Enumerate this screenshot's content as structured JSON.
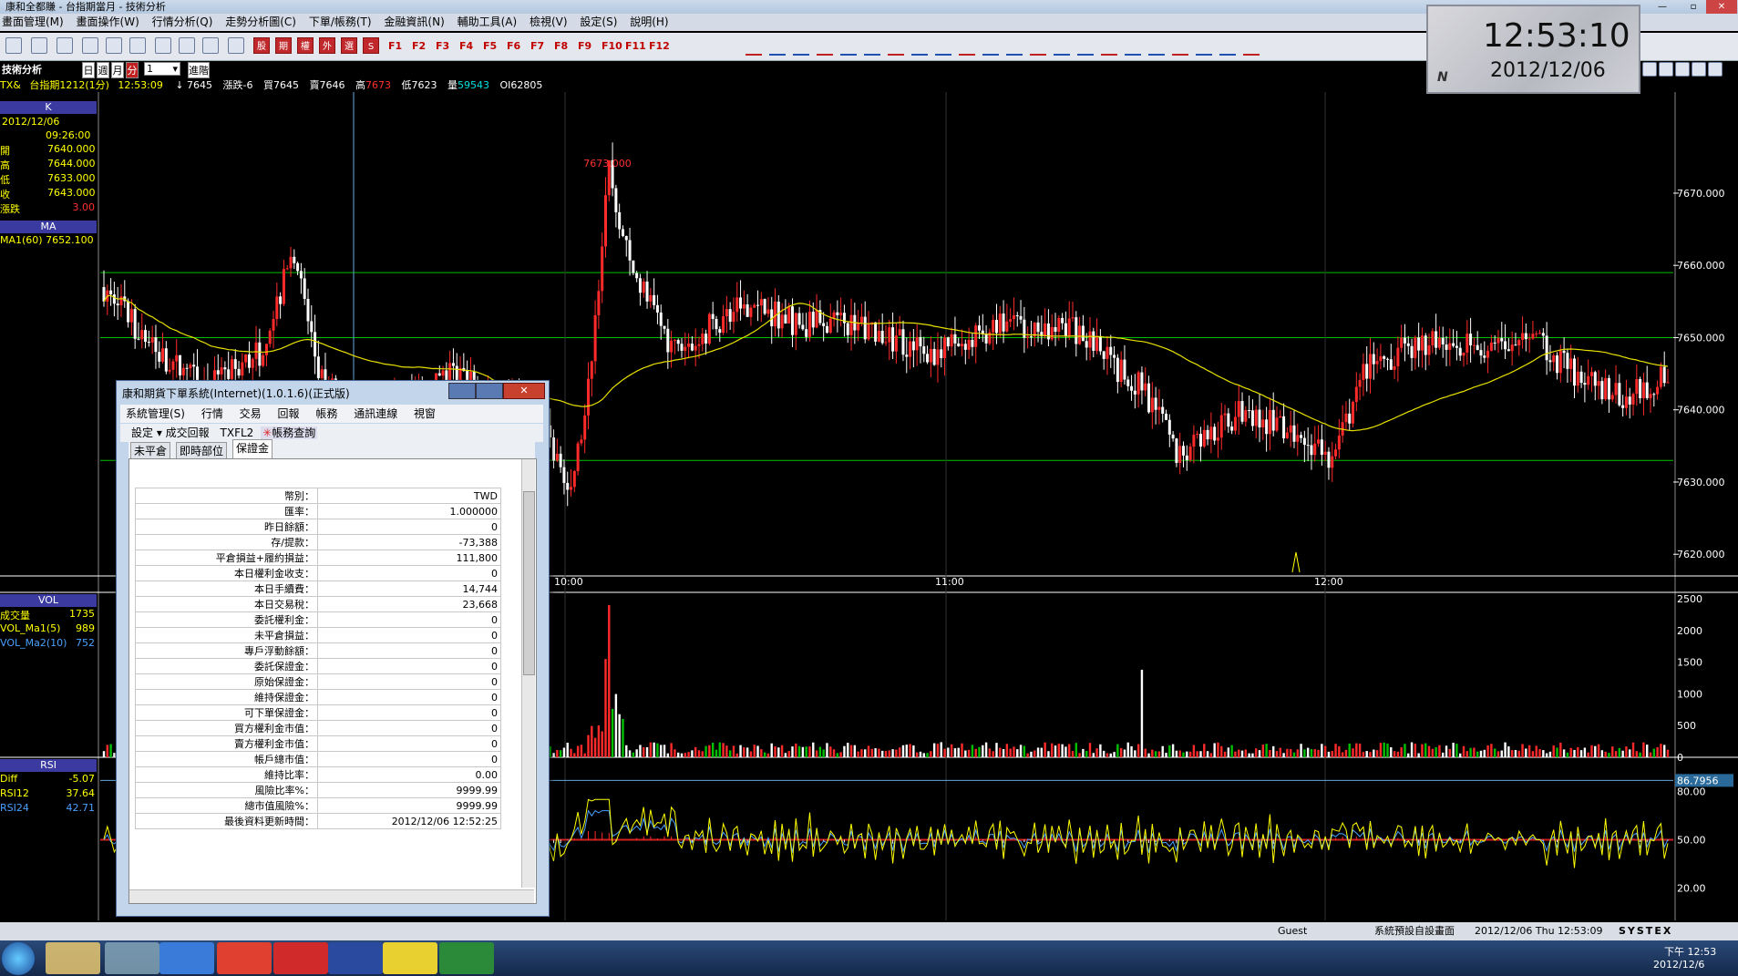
{
  "window": {
    "title": "康和全都賺 - 台指期當月 - 技術分析"
  },
  "menu": [
    "畫面管理(M)",
    "畫面操作(W)",
    "行情分析(Q)",
    "走勢分析圖(C)",
    "下單/帳務(T)",
    "金融資訊(N)",
    "輔助工具(A)",
    "檢視(V)",
    "設定(S)",
    "說明(H)"
  ],
  "toolbar": {
    "red_buttons": [
      "股",
      "期",
      "權",
      "外",
      "選",
      "S"
    ],
    "function_keys": [
      "F1",
      "F2",
      "F3",
      "F4",
      "F5",
      "F6",
      "F7",
      "F8",
      "F9",
      "F10",
      "F11",
      "F12"
    ]
  },
  "chart_panel": {
    "title": "技術分析",
    "period_tabs": [
      "日",
      "週",
      "月",
      "分"
    ],
    "active_period": "分",
    "interval_value": "1",
    "advanced_label": "進階",
    "symbol": "TX&",
    "symbol_name": "台指期1212(1分)",
    "time": "12:53:09",
    "last_arrow": "↓",
    "last": "7645",
    "change_label": "漲跌",
    "change": "-6",
    "bid_label": "買",
    "bid": "7645",
    "ask_label": "賣",
    "ask": "7646",
    "high_label": "高",
    "high": "7673",
    "low_label": "低",
    "low": "7623",
    "volume_label": "量",
    "volume": "59543",
    "oi_label": "OI",
    "oi": "62805"
  },
  "side": {
    "k_header": "K",
    "date": "2012/12/06",
    "time": "09:26:00",
    "ohlc": [
      {
        "label": "開",
        "value": "7640.000"
      },
      {
        "label": "高",
        "value": "7644.000"
      },
      {
        "label": "低",
        "value": "7633.000"
      },
      {
        "label": "收",
        "value": "7643.000"
      },
      {
        "label": "漲跌",
        "value": "3.00"
      }
    ],
    "ma_header": "MA",
    "ma_label": "MA1(60)",
    "ma_value": "7652.100",
    "vol_header": "VOL",
    "vol": [
      {
        "label": "成交量",
        "value": "1735"
      },
      {
        "label": "VOL_Ma1(5)",
        "value": "989"
      },
      {
        "label": "VOL_Ma2(10)",
        "value": "752"
      }
    ],
    "rsi_header": "RSI",
    "rsi": [
      {
        "label": "Diff",
        "value": "-5.07"
      },
      {
        "label": "RSI12",
        "value": "37.64"
      },
      {
        "label": "RSI24",
        "value": "42.71"
      }
    ]
  },
  "clock": {
    "time": "12:53:10",
    "date": "2012/12/06",
    "badge": "N"
  },
  "chart_data": [
    {
      "type": "candlestick",
      "title": "",
      "y_ticks": [
        "7670.000",
        "7660.000",
        "7650.000",
        "7640.000",
        "7630.000",
        "7620.000"
      ],
      "ylim": [
        7617,
        7684
      ],
      "x_tick_labels": [
        "10:00",
        "11:00",
        "12:00"
      ],
      "hlines": [
        7659,
        7650,
        7633
      ],
      "high_annotation": "7673.000",
      "grid": true,
      "series": [
        {
          "name": "MA1(60)"
        }
      ]
    },
    {
      "type": "bar",
      "title": "VOL",
      "y_ticks": [
        "2500",
        "2000",
        "1500",
        "1000",
        "500",
        "0"
      ],
      "ylim": [
        0,
        2600
      ]
    },
    {
      "type": "line",
      "title": "RSI",
      "y_ticks": [
        "86.7956",
        "80.00",
        "50.00",
        "20.00"
      ],
      "ylim": [
        0,
        100
      ],
      "series": [
        {
          "name": "RSI12"
        },
        {
          "name": "RSI24"
        }
      ]
    }
  ],
  "dialog": {
    "title": "康和期貨下單系統(Internet)(1.0.1.6)(正式版)",
    "menu": [
      "系統管理(S)",
      "行情",
      "交易",
      "回報",
      "帳務",
      "通訊連線",
      "視窗"
    ],
    "sub": {
      "settings": "設定",
      "fills": "成交回報",
      "product": "TXFL2",
      "account_query": "帳務查詢"
    },
    "tabs": [
      "未平倉",
      "即時部位",
      "保證金"
    ],
    "active_tab": "保證金",
    "rows": [
      {
        "k": "幣別：",
        "v": "TWD"
      },
      {
        "k": "匯率：",
        "v": "1.000000"
      },
      {
        "k": "昨日餘額：",
        "v": "0"
      },
      {
        "k": "存/提款：",
        "v": "-73,388"
      },
      {
        "k": "平倉損益+履約損益：",
        "v": "111,800"
      },
      {
        "k": "本日權利金收支：",
        "v": "0"
      },
      {
        "k": "本日手續費：",
        "v": "14,744"
      },
      {
        "k": "本日交易稅：",
        "v": "23,668"
      },
      {
        "k": "委託權利金：",
        "v": "0"
      },
      {
        "k": "未平倉損益：",
        "v": "0"
      },
      {
        "k": "專戶浮動餘額：",
        "v": "0"
      },
      {
        "k": "委託保證金：",
        "v": "0"
      },
      {
        "k": "原始保證金：",
        "v": "0"
      },
      {
        "k": "維持保證金：",
        "v": "0"
      },
      {
        "k": "可下單保證金：",
        "v": "0"
      },
      {
        "k": "買方權利金市值：",
        "v": "0"
      },
      {
        "k": "賣方權利金市值：",
        "v": "0"
      },
      {
        "k": "帳戶總市值：",
        "v": "0"
      },
      {
        "k": "維持比率：",
        "v": "0.00"
      },
      {
        "k": "風險比率%：",
        "v": "9999.99"
      },
      {
        "k": "總市值風險%：",
        "v": "9999.99"
      },
      {
        "k": "最後資料更新時間：",
        "v": "2012/12/06 12:52:25"
      }
    ]
  },
  "status": {
    "user": "Guest",
    "layout": "系統預設自設畫面",
    "datetime": "2012/12/06 Thu 12:53:09",
    "brand": "SYSTEX"
  },
  "taskbar": {
    "time": "下午 12:53",
    "date": "2012/12/6"
  },
  "colors": {
    "up": "#ff2a2a",
    "down": "#ffffff",
    "ma": "#e8e000",
    "grid_h": "#00c000",
    "rsi12": "#ffff00",
    "rsi24": "#4aa0ff",
    "vol_green": "#00c000"
  }
}
